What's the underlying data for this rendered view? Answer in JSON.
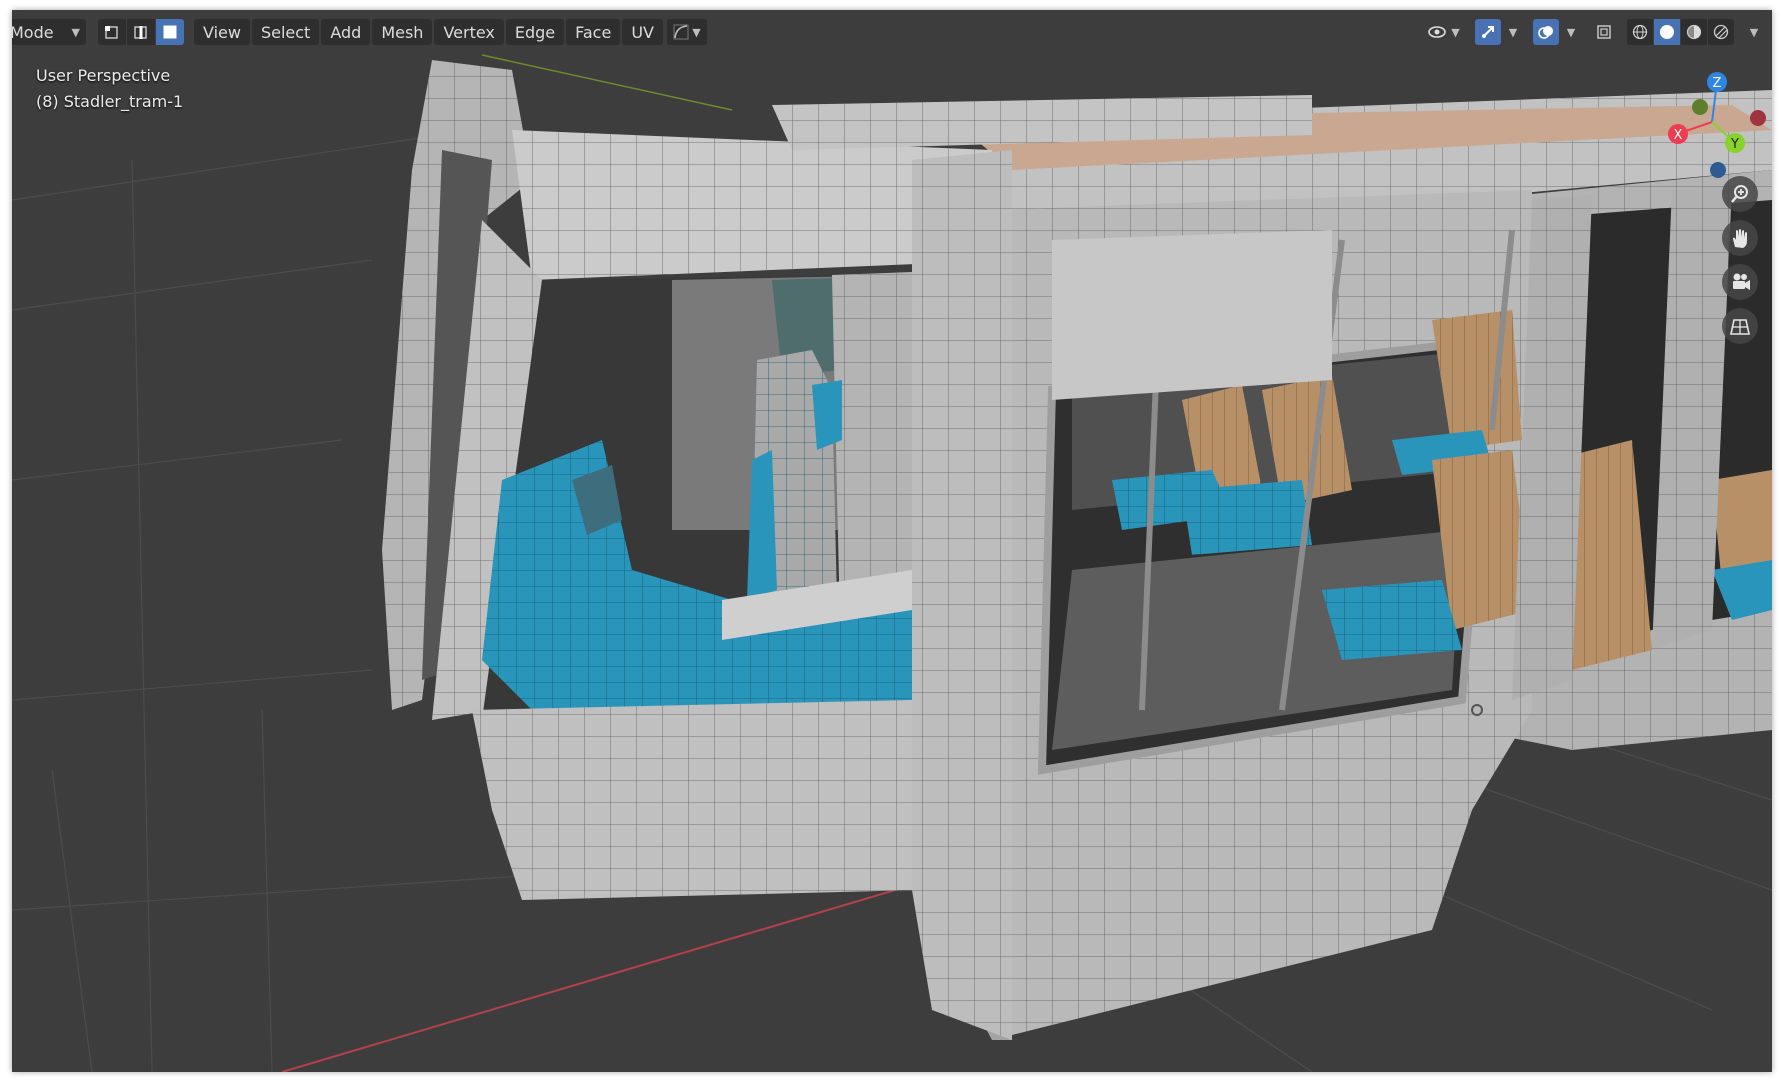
{
  "header": {
    "mode_label": "Mode",
    "menus": [
      "View",
      "Select",
      "Add",
      "Mesh",
      "Vertex",
      "Edge",
      "Face",
      "UV"
    ]
  },
  "viewport": {
    "view_name": "User Perspective",
    "object_info": "(8) Stadler_tram-1"
  },
  "gizmo": {
    "x": "X",
    "y": "Y",
    "z": "Z"
  },
  "icons": {
    "select_mode": [
      "vertex-select-icon",
      "edge-select-icon",
      "face-select-icon"
    ],
    "header_right": [
      "visibility-icon",
      "gizmo-icon",
      "overlay-icon",
      "xray-icon",
      "wireframe-shading-icon",
      "solid-shading-icon",
      "material-shading-icon",
      "rendered-shading-icon"
    ],
    "nav": [
      "zoom-icon",
      "pan-hand-icon",
      "camera-icon",
      "ortho-grid-icon"
    ]
  },
  "colors": {
    "background": "#3d3d3d",
    "mesh_gray": "#b9b9b9",
    "selected_face": "#2a95bb",
    "seat_wood": "#b89068",
    "accent": "#4772b3",
    "axis_x": "#ee3d51",
    "axis_y": "#89d12c",
    "axis_z": "#2e86e4"
  }
}
